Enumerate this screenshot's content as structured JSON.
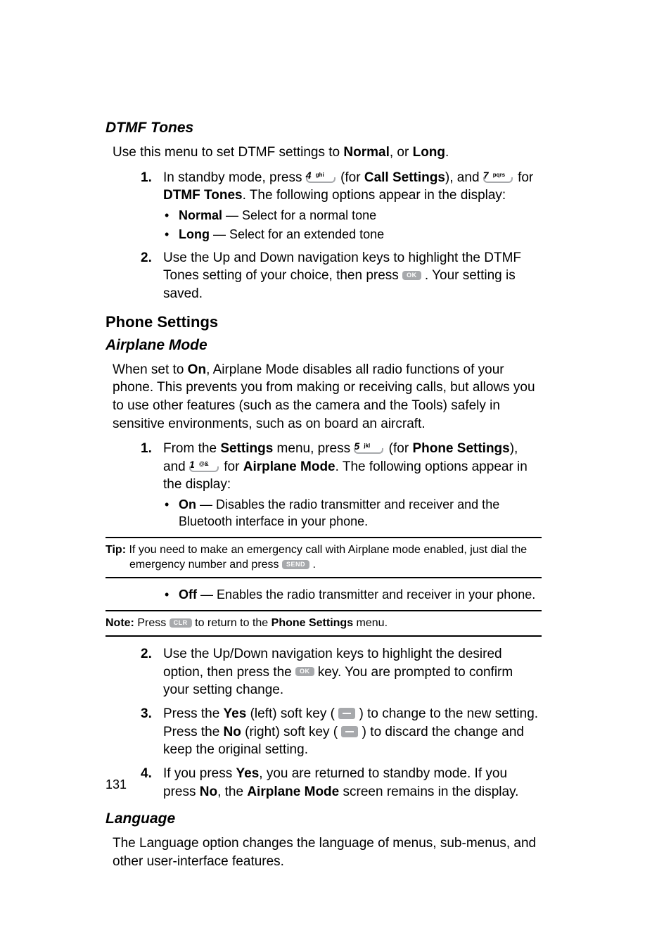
{
  "page_number": "131",
  "sections": {
    "dtmf": {
      "title": "DTMF Tones",
      "intro_pre": "Use this menu to set DTMF settings to ",
      "intro_b1": "Normal",
      "intro_mid": ", or ",
      "intro_b2": "Long",
      "intro_post": ".",
      "step1": {
        "num": "1.",
        "t1": "In standby mode, press ",
        "t2": " (for ",
        "b_call": "Call Settings",
        "t3": "), and ",
        "t4": " for ",
        "b_dtmf": "DTMF Tones",
        "t5": ". The following options appear in the display:",
        "bullets": {
          "normal_b": "Normal",
          "normal_t": " — Select for a normal tone",
          "long_b": "Long",
          "long_t": " — Select for an extended tone"
        }
      },
      "step2": {
        "num": "2.",
        "t1": "Use the Up and Down navigation keys to highlight the DTMF Tones setting of your choice, then press ",
        "t2": ". Your setting is saved."
      }
    },
    "phone_settings_heading": "Phone Settings",
    "airplane": {
      "title": "Airplane Mode",
      "intro_t1": "When set to ",
      "intro_b1": "On",
      "intro_t2": ", Airplane Mode disables all radio functions of your phone. This prevents you from making or receiving calls, but allows you to use other features (such as the camera and the Tools) safely in sensitive environments, such as on board an aircraft.",
      "step1": {
        "num": "1.",
        "t1": "From the ",
        "b_settings": "Settings",
        "t2": " menu, press ",
        "t3": " (for ",
        "b_phone": "Phone Settings",
        "t4": "), and ",
        "t5": " for ",
        "b_air": "Airplane Mode",
        "t6": ". The following options appear in the display:",
        "bullet_on_b": "On",
        "bullet_on_t": " — Disables the radio transmitter and receiver and the Bluetooth interface in your phone."
      },
      "tip": {
        "label": "Tip: ",
        "t1": "If you need to make an emergency call with Airplane mode enabled, just dial the emergency number and press ",
        "t2": "."
      },
      "bullet_off_b": "Off",
      "bullet_off_t": " — Enables the radio transmitter and receiver in your phone.",
      "note": {
        "label": "Note: ",
        "t1": "Press ",
        "t2": " to return to the ",
        "b_phone": "Phone Settings",
        "t3": " menu."
      },
      "step2": {
        "num": "2.",
        "t1": "Use the Up/Down navigation keys to highlight the desired option, then press the ",
        "t2": " key. You are prompted to confirm your setting change."
      },
      "step3": {
        "num": "3.",
        "t1": "Press the ",
        "b_yes": "Yes",
        "t2": " (left) soft key ( ",
        "t3": " ) to change to the new setting. Press the ",
        "b_no": "No",
        "t4": " (right) soft key ( ",
        "t5": " ) to discard the change and keep the original setting."
      },
      "step4": {
        "num": "4.",
        "t1": "If you press ",
        "b_yes": "Yes",
        "t2": ", you are returned to standby mode. If you press ",
        "b_no": "No",
        "t3": ", the ",
        "b_air": "Airplane Mode",
        "t4": " screen remains in the display."
      }
    },
    "language": {
      "title": "Language",
      "intro": "The Language option changes the language of menus, sub-menus, and other user-interface features."
    }
  },
  "keys": {
    "ok": "OK",
    "send": "SEND",
    "clr": "CLR",
    "k4_big": "4",
    "k4_small": "ghi",
    "k7_big": "7",
    "k7_small": "pqrs",
    "k5_big": "5",
    "k5_small": "jkl",
    "k1_big": "1",
    "k1_small": "@&"
  }
}
